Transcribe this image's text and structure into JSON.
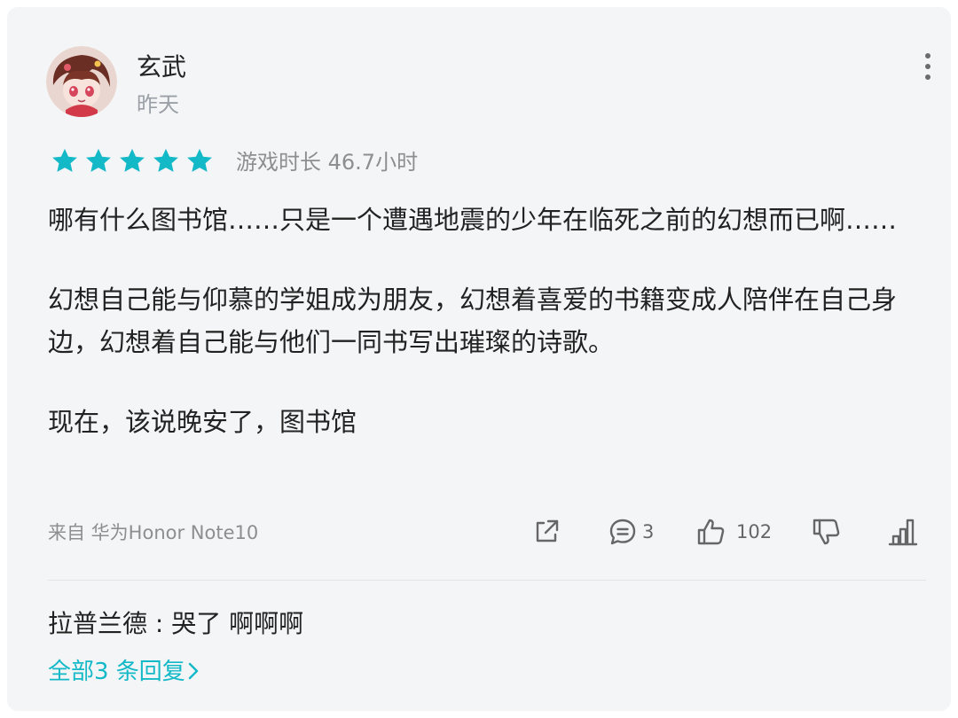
{
  "review": {
    "username": "玄武",
    "time": "昨天",
    "rating_stars": 5,
    "rating_color": "#14b9c8",
    "playtime": "游戏时长 46.7小时",
    "paragraphs": [
      "哪有什么图书馆……只是一个遭遇地震的少年在临死之前的幻想而已啊……",
      "幻想自己能与仰慕的学姐成为朋友，幻想着喜爱的书籍变成人陪伴在自己身边，幻想着自己能与他们一同书写出璀璨的诗歌。",
      "现在，该说晚安了，图书馆"
    ],
    "device": "来自 华为Honor Note10",
    "actions": {
      "share_icon": "share-icon",
      "comment_icon": "comment-icon",
      "comment_count": "3",
      "like_icon": "thumbs-up-icon",
      "like_count": "102",
      "dislike_icon": "thumbs-down-icon",
      "stats_icon": "bar-chart-icon"
    }
  },
  "replies": {
    "preview": "拉普兰德 : 哭了 啊啊啊",
    "view_all": "全部3 条回复"
  }
}
